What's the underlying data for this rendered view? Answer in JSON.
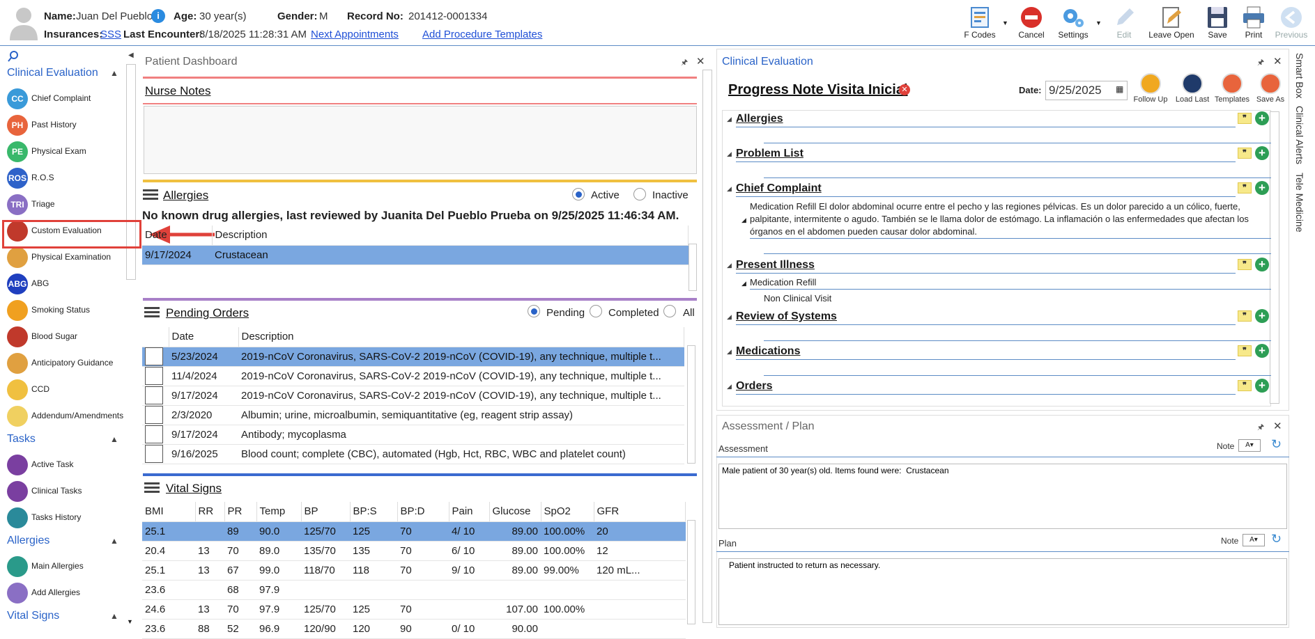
{
  "header": {
    "name_label": "Name:",
    "name_value": "Juan Del Pueblo",
    "age_label": "Age:",
    "age_value": "30 year(s)",
    "gender_label": "Gender:",
    "gender_value": "M",
    "record_label": "Record No:",
    "record_value": "201412-0001334",
    "insurances_label": "Insurances:",
    "insurances_value": "SSS",
    "last_encounter_label": "Last Encounter:",
    "last_encounter_value": "8/18/2025 11:28:31 AM",
    "next_appointments": "Next Appointments",
    "add_procedure_templates": "Add Procedure Templates"
  },
  "toolbar": {
    "fcodes": "F Codes",
    "cancel": "Cancel",
    "settings": "Settings",
    "edit": "Edit",
    "leave_open": "Leave Open",
    "save": "Save",
    "print": "Print",
    "previous": "Previous"
  },
  "nav": {
    "clinical_evaluation": "Clinical Evaluation",
    "items": [
      {
        "abbr": "CC",
        "label": "Chief Complaint",
        "color": "#3a9ad9"
      },
      {
        "abbr": "PH",
        "label": "Past History",
        "color": "#e8643c"
      },
      {
        "abbr": "PE",
        "label": "Physical Exam",
        "color": "#39b86b"
      },
      {
        "abbr": "ROS",
        "label": "R.O.S",
        "color": "#2e62c9"
      },
      {
        "abbr": "TRI",
        "label": "Triage",
        "color": "#8a6fc4"
      },
      {
        "abbr": "",
        "label": "Custom Evaluation",
        "color": "#c0392b"
      },
      {
        "abbr": "",
        "label": "Physical Examination",
        "color": "#e0a040"
      },
      {
        "abbr": "ABG",
        "label": "ABG",
        "color": "#1f3fbf"
      },
      {
        "abbr": "",
        "label": "Smoking Status",
        "color": "#f0a020"
      },
      {
        "abbr": "",
        "label": "Blood Sugar",
        "color": "#c0392b"
      },
      {
        "abbr": "",
        "label": "Anticipatory Guidance",
        "color": "#e0a040"
      },
      {
        "abbr": "",
        "label": "CCD",
        "color": "#f0c040"
      },
      {
        "abbr": "",
        "label": "Addendum/Amendments",
        "color": "#f0d060"
      }
    ],
    "tasks": "Tasks",
    "task_items": [
      {
        "label": "Active Task",
        "color": "#7a3fa0"
      },
      {
        "label": "Clinical Tasks",
        "color": "#7a3fa0"
      },
      {
        "label": "Tasks History",
        "color": "#2a8a9a"
      }
    ],
    "allergies": "Allergies",
    "allergy_items": [
      {
        "label": "Main Allergies",
        "color": "#2a9a8a"
      },
      {
        "label": "Add Allergies",
        "color": "#8a6fc4"
      }
    ],
    "vital_signs": "Vital Signs"
  },
  "dashboard": {
    "title": "Patient Dashboard",
    "nurse_notes": "Nurse Notes",
    "allergies": {
      "title": "Allergies",
      "active": "Active",
      "inactive": "Inactive",
      "message": "No known drug allergies, last reviewed by Juanita Del Pueblo Prueba on 9/25/2025 11:46:34 AM.",
      "col_date": "Date",
      "col_description": "Description",
      "rows": [
        {
          "date": "9/17/2024",
          "description": "Crustacean"
        }
      ]
    },
    "pending_orders": {
      "title": "Pending Orders",
      "pending": "Pending",
      "completed": "Completed",
      "all": "All",
      "col_date": "Date",
      "col_description": "Description",
      "rows": [
        {
          "date": "5/23/2024",
          "description": "2019-nCoV Coronavirus, SARS-CoV-2 2019-nCoV (COVID-19), any technique, multiple t..."
        },
        {
          "date": "11/4/2024",
          "description": "2019-nCoV Coronavirus, SARS-CoV-2 2019-nCoV (COVID-19), any technique, multiple t..."
        },
        {
          "date": "9/17/2024",
          "description": "2019-nCoV Coronavirus, SARS-CoV-2 2019-nCoV (COVID-19), any technique, multiple t..."
        },
        {
          "date": "2/3/2020",
          "description": "Albumin; urine, microalbumin, semiquantitative (eg, reagent strip assay)"
        },
        {
          "date": "9/17/2024",
          "description": "Antibody; mycoplasma"
        },
        {
          "date": "9/16/2025",
          "description": "Blood count; complete (CBC), automated (Hgb, Hct, RBC, WBC and platelet count)"
        }
      ]
    },
    "vital_signs": {
      "title": "Vital Signs",
      "columns": [
        "BMI",
        "RR",
        "PR",
        "Temp",
        "BP",
        "BP:S",
        "BP:D",
        "Pain",
        "Glucose",
        "SpO2",
        "GFR"
      ],
      "rows": [
        [
          "25.1",
          "",
          "89",
          "90.0",
          "125/70",
          "125",
          "70",
          "4/ 10",
          "89.00",
          "100.00%",
          "20"
        ],
        [
          "20.4",
          "13",
          "70",
          "89.0",
          "135/70",
          "135",
          "70",
          "6/ 10",
          "89.00",
          "100.00%",
          "12"
        ],
        [
          "25.1",
          "13",
          "67",
          "99.0",
          "118/70",
          "118",
          "70",
          "9/ 10",
          "89.00",
          "99.00%",
          "120 mL..."
        ],
        [
          "23.6",
          "",
          "68",
          "97.9",
          "",
          "",
          "",
          "",
          "",
          "",
          ""
        ],
        [
          "24.6",
          "13",
          "70",
          "97.9",
          "125/70",
          "125",
          "70",
          "",
          "107.00",
          "100.00%",
          ""
        ],
        [
          "23.6",
          "88",
          "52",
          "96.9",
          "120/90",
          "120",
          "90",
          "0/ 10",
          "90.00",
          "",
          ""
        ]
      ]
    }
  },
  "clinical": {
    "title": "Clinical Evaluation",
    "note_title": "Progress Note Visita Inicial",
    "date_label": "Date:",
    "date_value": "9/25/2025",
    "follow_up": "Follow Up",
    "load_last": "Load Last",
    "templates": "Templates",
    "save_as": "Save As",
    "sections": {
      "allergies": "Allergies",
      "problem_list": "Problem List",
      "chief_complaint": "Chief Complaint",
      "chief_complaint_text": "Medication Refill El dolor abdominal ocurre entre el pecho y las regiones pélvicas. Es un dolor parecido a un cólico, fuerte, palpitante, intermitente o agudo. También se le llama dolor de estómago. La inflamación o las enfermedades que afectan los órganos en el abdomen pueden causar dolor abdominal.",
      "present_illness": "Present Illness",
      "present_illness_item": "Medication Refill",
      "present_illness_sub": "Non Clinical Visit",
      "review_of_systems": "Review of Systems",
      "medications": "Medications",
      "orders": "Orders"
    }
  },
  "assessment": {
    "title": "Assessment / Plan",
    "assessment_label": "Assessment",
    "note_label": "Note",
    "assessment_text": "Male patient of 30 year(s) old. Items found were:  Crustacean",
    "plan_label": "Plan",
    "plan_note_label": "Note",
    "plan_text": "Patient instructed to return as necessary."
  },
  "side_tabs": {
    "smart_box": "Smart Box",
    "clinical_alerts": "Clinical Alerts",
    "tele_medicine": "Tele Medicine"
  },
  "colors": {
    "accent": "#2a63c8",
    "selected_row": "#7aa7e0",
    "highlight_box": "#e0413a"
  }
}
